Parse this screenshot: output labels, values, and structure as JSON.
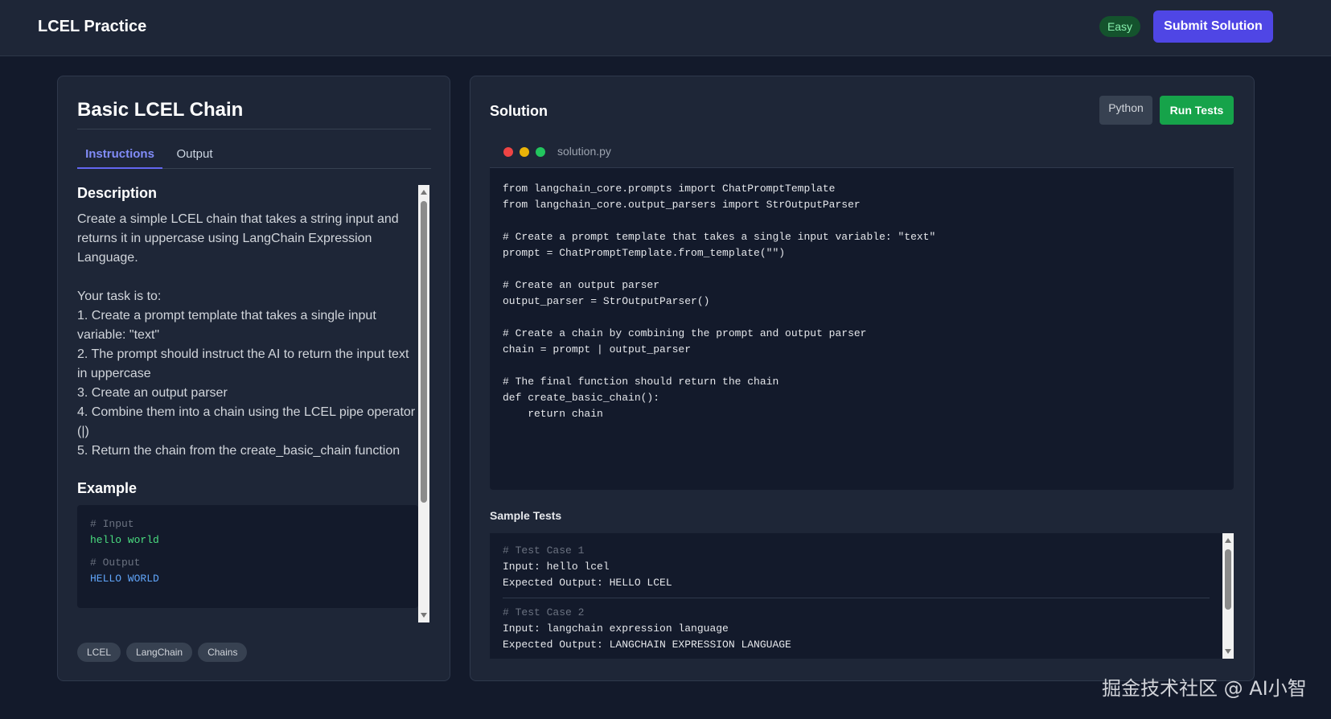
{
  "header": {
    "brand": "LCEL Practice",
    "difficulty": "Easy",
    "submit_label": "Submit Solution"
  },
  "problem": {
    "title": "Basic LCEL Chain",
    "tabs": [
      {
        "label": "Instructions",
        "active": true
      },
      {
        "label": "Output",
        "active": false
      }
    ],
    "description_heading": "Description",
    "description": "Create a simple LCEL chain that takes a string input and returns it in uppercase using LangChain Expression Language.\n\nYour task is to:\n1. Create a prompt template that takes a single input variable: \"text\"\n2. The prompt should instruct the AI to return the input text in uppercase\n3. Create an output parser\n4. Combine them into a chain using the LCEL pipe operator (|)\n5. Return the chain from the create_basic_chain function",
    "example_heading": "Example",
    "example": {
      "input_comment": "# Input",
      "input": "hello world",
      "output_comment": "# Output",
      "output": "HELLO WORLD"
    },
    "tags": [
      "LCEL",
      "LangChain",
      "Chains"
    ]
  },
  "solution": {
    "title": "Solution",
    "language": "Python",
    "run_label": "Run Tests",
    "file_name": "solution.py",
    "code": "from langchain_core.prompts import ChatPromptTemplate\nfrom langchain_core.output_parsers import StrOutputParser\n\n# Create a prompt template that takes a single input variable: \"text\"\nprompt = ChatPromptTemplate.from_template(\"\")\n\n# Create an output parser\noutput_parser = StrOutputParser()\n\n# Create a chain by combining the prompt and output parser\nchain = prompt | output_parser\n\n# The final function should return the chain\ndef create_basic_chain():\n    return chain"
  },
  "tests": {
    "heading": "Sample Tests",
    "cases": [
      {
        "comment": "# Test Case 1",
        "input": "Input: hello lcel",
        "expected": "Expected Output: HELLO LCEL"
      },
      {
        "comment": "# Test Case 2",
        "input": "Input: langchain expression language",
        "expected": "Expected Output: LANGCHAIN EXPRESSION LANGUAGE"
      }
    ]
  },
  "watermark": "掘金技术社区 @ AI小智",
  "colors": {
    "background": "#131a2b",
    "panel": "#1e2637",
    "accent": "#4f46e5",
    "run": "#16a34a",
    "easy_badge": "#14532d"
  }
}
